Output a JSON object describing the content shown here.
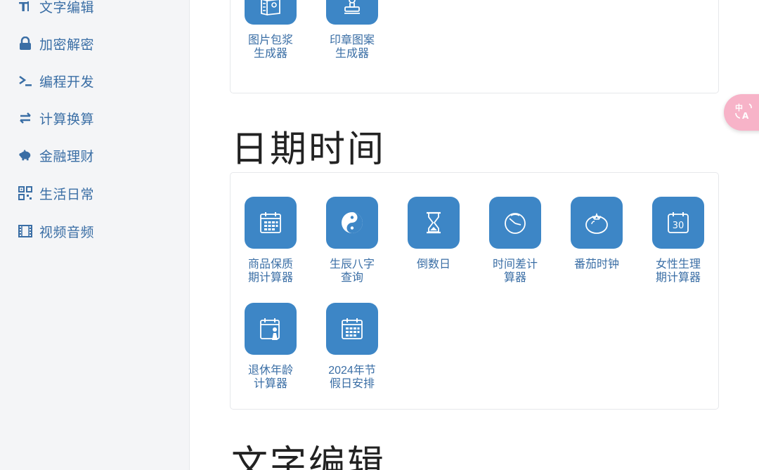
{
  "sidebar": {
    "items": [
      {
        "label": "文字编辑",
        "icon": "text-edit-icon"
      },
      {
        "label": "加密解密",
        "icon": "lock-icon"
      },
      {
        "label": "编程开发",
        "icon": "terminal-icon"
      },
      {
        "label": "计算换算",
        "icon": "exchange-icon"
      },
      {
        "label": "金融理财",
        "icon": "piggy-bank-icon"
      },
      {
        "label": "生活日常",
        "icon": "qrcode-icon"
      },
      {
        "label": "视频音频",
        "icon": "film-icon"
      }
    ]
  },
  "image_card": {
    "tools": [
      {
        "line1": "图片包浆",
        "line2": "生成器",
        "icon": "image-map-icon"
      },
      {
        "line1": "印章图案",
        "line2": "生成器",
        "icon": "stamp-icon"
      }
    ]
  },
  "date_section": {
    "title": "日期时间",
    "tools": [
      {
        "line1": "商品保质",
        "line2": "期计算器",
        "icon": "calendar-grid-icon"
      },
      {
        "line1": "生辰八字",
        "line2": "查询",
        "icon": "yin-yang-icon"
      },
      {
        "line1": "倒数日",
        "line2": "",
        "icon": "hourglass-icon"
      },
      {
        "line1": "时间差计",
        "line2": "算器",
        "icon": "clock-icon"
      },
      {
        "line1": "番茄时钟",
        "line2": "",
        "icon": "tomato-icon"
      },
      {
        "line1": "女性生理",
        "line2": "期计算器",
        "icon": "calendar-30-icon"
      },
      {
        "line1": "退休年龄",
        "line2": "计算器",
        "icon": "calendar-person-icon"
      },
      {
        "line1": "2024年节",
        "line2": "假日安排",
        "icon": "calendar-grid-icon"
      }
    ]
  },
  "next_section": {
    "title": "文字编辑"
  },
  "colors": {
    "accent": "#3d86c6",
    "sidebar_text": "#3a6ea5",
    "translate_button": "#f7b3c8"
  },
  "floating": {
    "icon": "translate-icon"
  }
}
